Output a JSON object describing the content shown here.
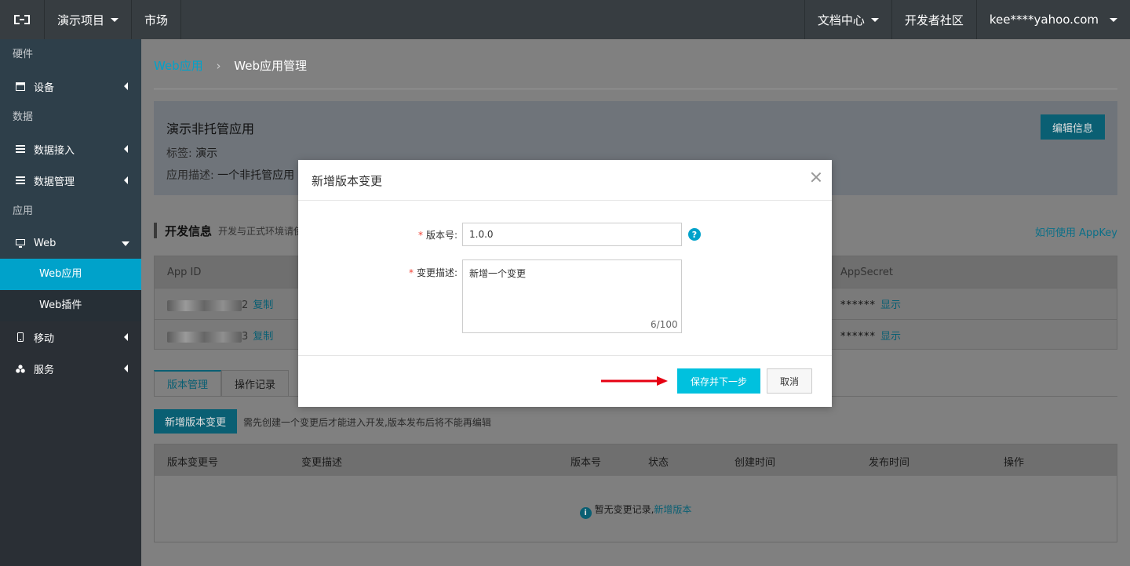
{
  "topbar": {
    "project": "演示项目",
    "market": "市场",
    "docs": "文档中心",
    "community": "开发者社区",
    "account": "kee****yahoo.com"
  },
  "sidebar": {
    "group_hardware": "硬件",
    "device": "设备",
    "group_data": "数据",
    "data_access": "数据接入",
    "data_manage": "数据管理",
    "group_app": "应用",
    "web": "Web",
    "web_app": "Web应用",
    "web_plugin": "Web插件",
    "mobile": "移动",
    "service": "服务"
  },
  "breadcrumb": {
    "parent": "Web应用",
    "current": "Web应用管理"
  },
  "app": {
    "name": "演示非托管应用",
    "tag_label": "标签:",
    "tag_value": "演示",
    "desc_label": "应用描述:",
    "desc_value": "一个非托管应用",
    "edit_button": "编辑信息"
  },
  "dev_info": {
    "title": "开发信息",
    "subtitle": "开发与正式环境请使",
    "appkey_link": "如何使用 AppKey",
    "col_appid": "App ID",
    "col_secret": "AppSecret",
    "rows": [
      {
        "id_suffix": "2",
        "copy": "复制",
        "secret": "******",
        "show": "显示"
      },
      {
        "id_suffix": "3",
        "copy": "复制",
        "secret": "******",
        "show": "显示"
      }
    ]
  },
  "tabs": [
    "版本管理",
    "操作记录"
  ],
  "version": {
    "new_button": "新增版本变更",
    "tip": "需先创建一个变更后才能进入开发,版本发布后将不能再编辑",
    "columns": [
      "版本变更号",
      "变更描述",
      "版本号",
      "状态",
      "创建时间",
      "发布时间",
      "操作"
    ],
    "empty_text": "暂无变更记录,",
    "empty_link": "新增版本"
  },
  "modal": {
    "title": "新增版本变更",
    "version_label": "版本号:",
    "version_value": "1.0.0",
    "desc_label": "变更描述:",
    "desc_value": "新增一个变更",
    "desc_count": "6/100",
    "save_button": "保存并下一步",
    "cancel_button": "取消"
  },
  "colors": {
    "accent": "#00c1de",
    "link": "#00a2ca",
    "required": "#f04134",
    "annotation_arrow": "#e60012"
  }
}
